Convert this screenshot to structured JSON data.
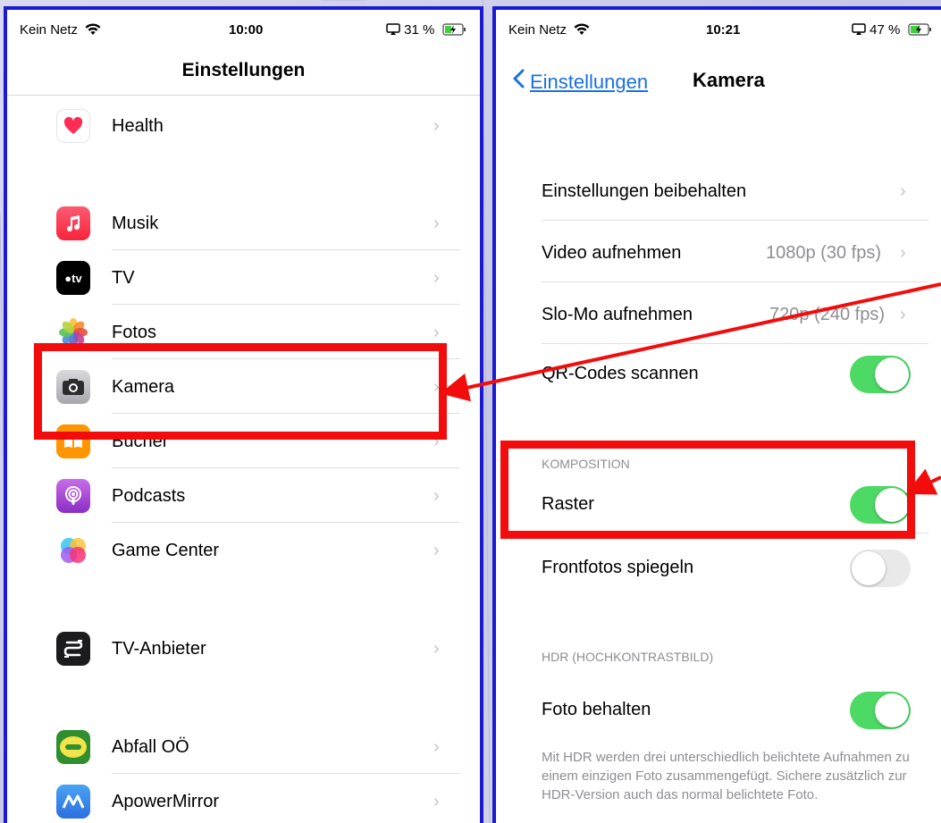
{
  "left_screen": {
    "status": {
      "carrier": "Kein Netz",
      "time": "10:00",
      "battery": "31 %"
    },
    "title": "Einstellungen",
    "rows": [
      {
        "label": "Health",
        "icon": "heart-icon"
      },
      {
        "label": "Musik",
        "icon": "music-icon"
      },
      {
        "label": "TV",
        "icon": "appletv-icon"
      },
      {
        "label": "Fotos",
        "icon": "photos-icon"
      },
      {
        "label": "Kamera",
        "icon": "camera-icon"
      },
      {
        "label": "Bücher",
        "icon": "books-icon"
      },
      {
        "label": "Podcasts",
        "icon": "podcasts-icon"
      },
      {
        "label": "Game Center",
        "icon": "gamecenter-icon"
      },
      {
        "label": "TV-Anbieter",
        "icon": "tvprovider-icon"
      },
      {
        "label": "Abfall OÖ",
        "icon": "abfall-icon"
      },
      {
        "label": "ApowerMirror",
        "icon": "apowermirror-icon"
      }
    ]
  },
  "right_screen": {
    "status": {
      "carrier": "Kein Netz",
      "time": "10:21",
      "battery": "47 %"
    },
    "back_label": "Einstellungen",
    "title": "Kamera",
    "rows": {
      "keep_settings": {
        "label": "Einstellungen beibehalten"
      },
      "record_video": {
        "label": "Video aufnehmen",
        "value": "1080p (30 fps)"
      },
      "record_slomo": {
        "label": "Slo-Mo aufnehmen",
        "value": "720p (240 fps)"
      },
      "scan_qr": {
        "label": "QR-Codes scannen",
        "enabled": true
      },
      "grid": {
        "label": "Raster",
        "enabled": true
      },
      "mirror_front": {
        "label": "Frontfotos spiegeln",
        "enabled": false
      },
      "keep_photo": {
        "label": "Foto behalten",
        "enabled": true
      }
    },
    "section_composition": "KOMPOSITION",
    "section_hdr": "HDR (HOCHKONTRASTBILD)",
    "hdr_footnote": "Mit HDR werden drei unterschiedlich belichtete Aufnahmen zu einem einzigen Foto zusammengefügt. Sichere zusätzlich zur HDR-Version auch das normal belichtete Foto."
  },
  "colors": {
    "frame": "#1a1ad6",
    "highlight": "#f20c0c",
    "toggle_on": "#4cd964",
    "link": "#1a6fe0"
  }
}
